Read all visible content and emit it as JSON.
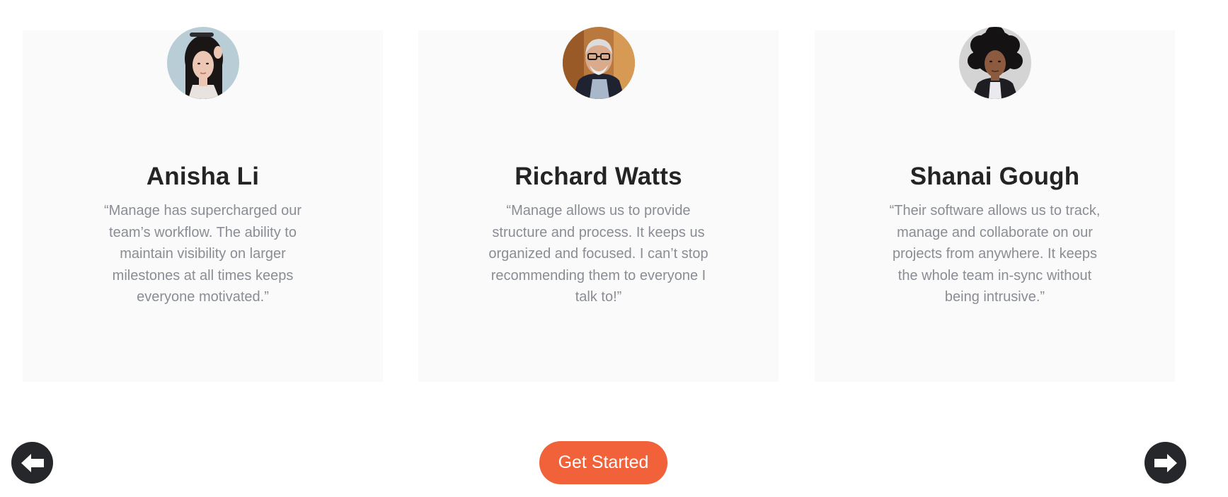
{
  "testimonials": [
    {
      "name": "Anisha Li",
      "quote": "“Manage has supercharged our team’s workflow. The ability to maintain visibility on larger milestones at all times keeps everyone motivated.”"
    },
    {
      "name": "Richard Watts",
      "quote": "“Manage allows us to provide structure and process. It keeps us organized and focused. I can’t stop recommending them to everyone I talk to!”"
    },
    {
      "name": "Shanai Gough",
      "quote": "“Their software allows us to track, manage and collaborate on our projects from anywhere. It keeps the whole team in-sync without being intrusive.”"
    }
  ],
  "cta": {
    "label": "Get Started"
  },
  "navigation": {
    "prev_icon": "arrow-left-icon",
    "next_icon": "arrow-right-icon"
  },
  "colors": {
    "card_background": "#fafafa",
    "heading": "#242424",
    "quote_text": "#8a8d94",
    "cta_background": "#f1623a",
    "cta_text": "#ffffff",
    "nav_button": "#25272b"
  }
}
